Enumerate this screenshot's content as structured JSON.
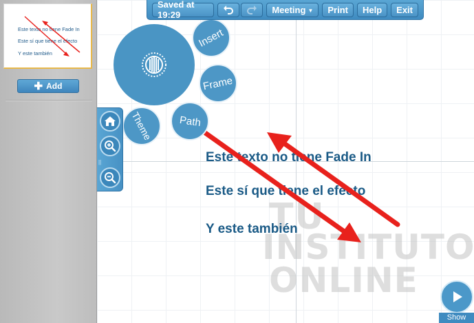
{
  "sidebar": {
    "thumbnail_lines": [
      "Este texto no tiene Fade In",
      "Este sí que tiene el efecto",
      "Y este también"
    ],
    "add_label": "Add"
  },
  "toolbar": {
    "saved_label": "Saved at 19:29",
    "undo_icon": "undo-icon",
    "redo_icon": "redo-icon",
    "meeting_label": "Meeting",
    "print_label": "Print",
    "help_label": "Help",
    "exit_label": "Exit"
  },
  "bubble_menu": {
    "insert_label": "Insert",
    "frame_label": "Frame",
    "path_label": "Path",
    "theme_label": "Theme"
  },
  "zoom_panel": {
    "home_icon": "home-icon",
    "zoom_in_icon": "zoom-in-icon",
    "zoom_out_icon": "zoom-out-icon"
  },
  "canvas": {
    "lines": [
      "Este texto no tiene Fade In",
      "Este sí que tiene el efecto",
      "Y este también"
    ],
    "watermark": [
      "TU",
      "INSTITUTO",
      "ONLINE"
    ]
  },
  "show_label": "Show",
  "colors": {
    "accent": "#4a95c4",
    "text": "#1a5a86",
    "arrow": "#e8211c"
  }
}
